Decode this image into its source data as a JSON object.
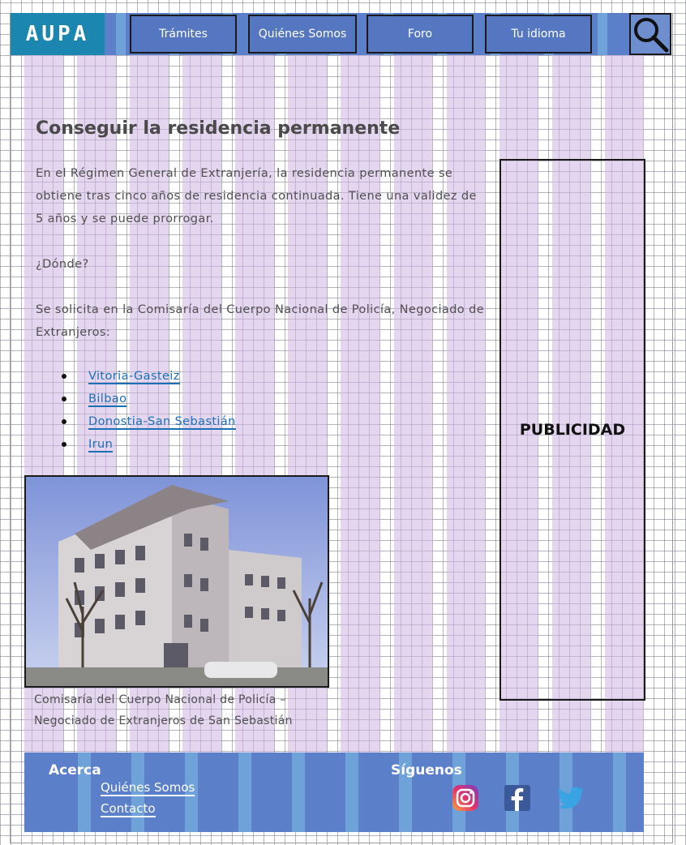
{
  "header": {
    "logo": "AUPA",
    "nav": [
      "Trámites",
      "Quiénes Somos",
      "Foro",
      "Tu idioma"
    ],
    "search_icon": "search-icon"
  },
  "main": {
    "title": "Conseguir la residencia permanente",
    "intro": "En el Régimen General de Extranjería, la residencia permanente se obtiene tras cinco años de residencia continuada. Tiene una validez de 5 años y se puede prorrogar.",
    "where_heading": "¿Dónde?",
    "where_text": "Se solicita en la Comisaría del Cuerpo Nacional de Policía, Negociado de Extranjeros:",
    "locations": [
      "Vitoria-Gasteiz",
      "Bilbao",
      "Donostia-San Sebastián",
      "Irun"
    ],
    "photo_caption": "Comisaría del Cuerpo Nacional de Policía – Negociado de Extranjeros de San Sebastián"
  },
  "sidebar": {
    "ad_label": "PUBLICIDAD"
  },
  "footer": {
    "about_heading": "Acerca",
    "about_links": [
      "Quiénes Somos",
      "Contacto"
    ],
    "follow_heading": "Síguenos",
    "social_icons": [
      "instagram-icon",
      "facebook-icon",
      "twitter-icon"
    ]
  },
  "colors": {
    "header_blue": "#5b7fc8",
    "logo_teal": "#1b86b0",
    "link_blue": "#1b6fb4",
    "grid_purple": "#cdb4e1"
  }
}
